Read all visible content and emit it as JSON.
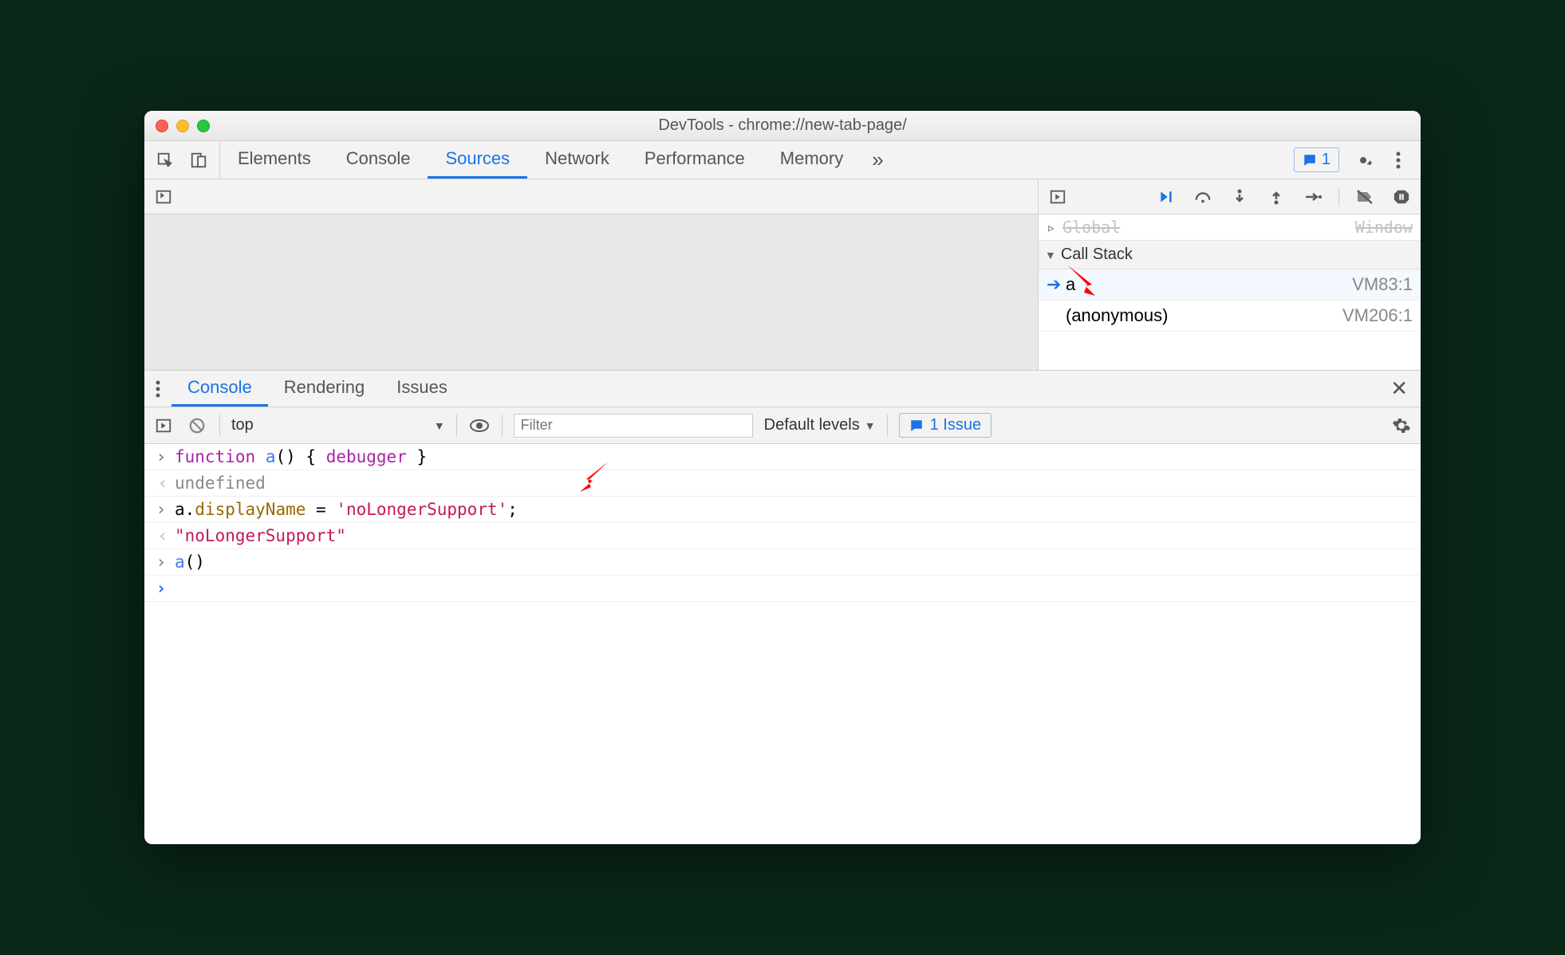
{
  "window": {
    "title": "DevTools - chrome://new-tab-page/"
  },
  "topTabs": {
    "items": [
      "Elements",
      "Console",
      "Sources",
      "Network",
      "Performance",
      "Memory"
    ],
    "activeIndex": 2
  },
  "topRight": {
    "issuesBadgeCount": "1"
  },
  "debugger": {
    "scopeGlobalLabel": "Global",
    "scopeGlobalValue": "Window",
    "callStackLabel": "Call Stack",
    "frames": [
      {
        "name": "a",
        "location": "VM83:1",
        "active": true
      },
      {
        "name": "(anonymous)",
        "location": "VM206:1",
        "active": false
      }
    ]
  },
  "drawerTabs": {
    "items": [
      "Console",
      "Rendering",
      "Issues"
    ],
    "activeIndex": 0
  },
  "consoleToolbar": {
    "context": "top",
    "filterPlaceholder": "Filter",
    "levelsLabel": "Default levels",
    "issuesPill": "1 Issue"
  },
  "consoleLines": [
    {
      "type": "input",
      "html": "<span class='kw'>function</span> <span class='fn'>a</span>() { <span class='dbgkw'>debugger</span> }"
    },
    {
      "type": "output",
      "html": "<span class='undef'>undefined</span>"
    },
    {
      "type": "input",
      "html": "a.<span class='prop'>displayName</span> = <span class='str'>'noLongerSupport'</span>;"
    },
    {
      "type": "output",
      "html": "<span class='retstr'>\"noLongerSupport\"</span>"
    },
    {
      "type": "input",
      "html": "<span class='fn'>a</span>()"
    },
    {
      "type": "prompt",
      "html": ""
    }
  ]
}
